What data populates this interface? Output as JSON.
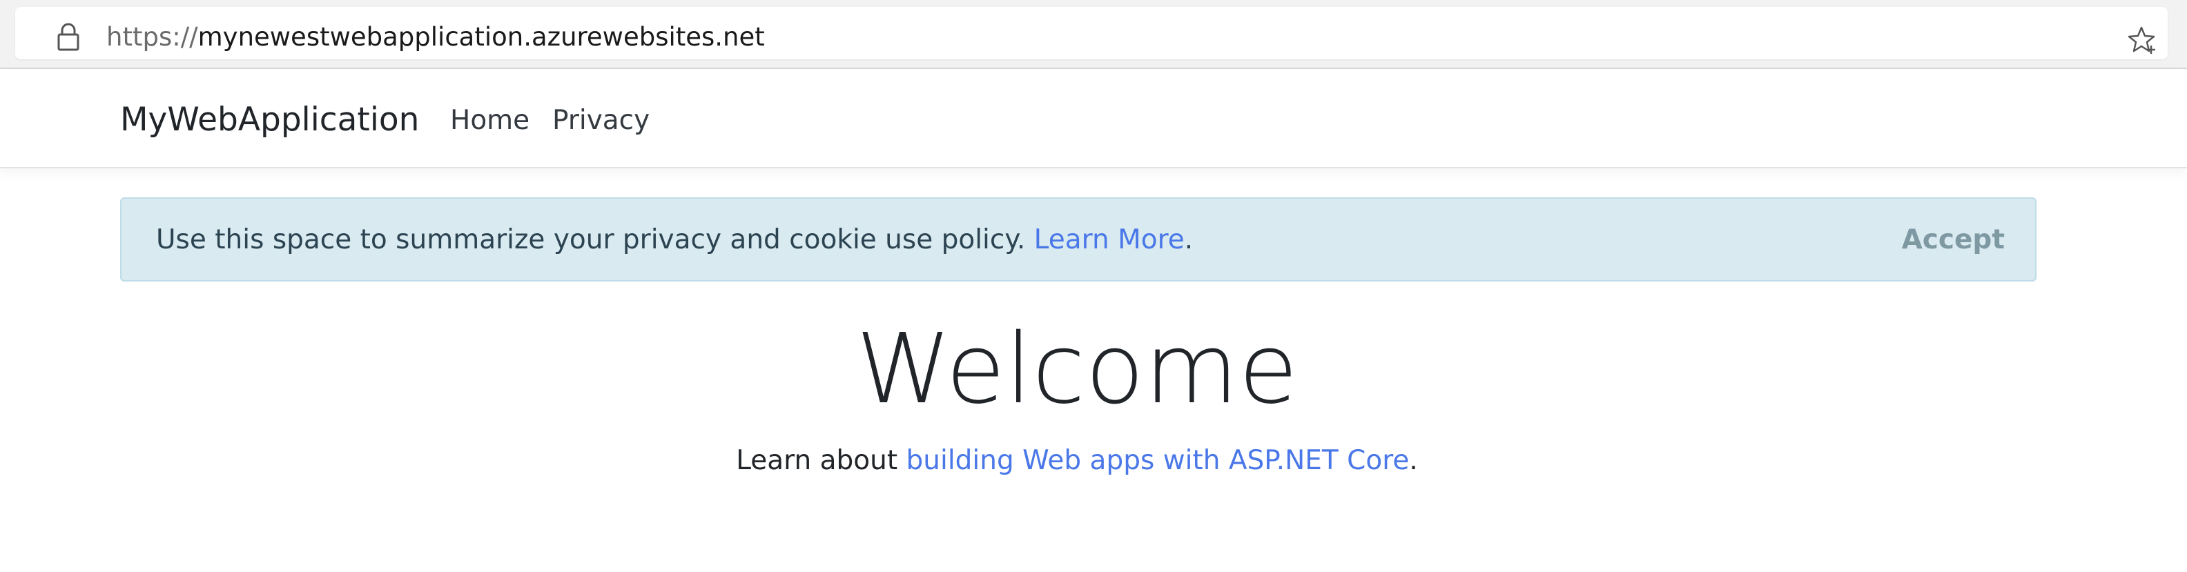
{
  "browser": {
    "url_scheme": "https://",
    "url_host": "mynewestwebapplication.azurewebsites.net",
    "lock_icon": "lock-icon",
    "favorite_icon": "add-favorite-star-icon"
  },
  "navbar": {
    "brand": "MyWebApplication",
    "links": [
      {
        "label": "Home"
      },
      {
        "label": "Privacy"
      }
    ]
  },
  "cookie_banner": {
    "text": "Use this space to summarize your privacy and cookie use policy.",
    "link_label": "Learn More",
    "trailing": ".",
    "accept_label": "Accept"
  },
  "main": {
    "heading": "Welcome",
    "learn_prefix": "Learn about",
    "learn_link": "building Web apps with ASP.NET Core",
    "learn_suffix": "."
  },
  "colors": {
    "link": "#4a78e8",
    "alert_background": "#d9eaf0",
    "text": "#212529"
  }
}
